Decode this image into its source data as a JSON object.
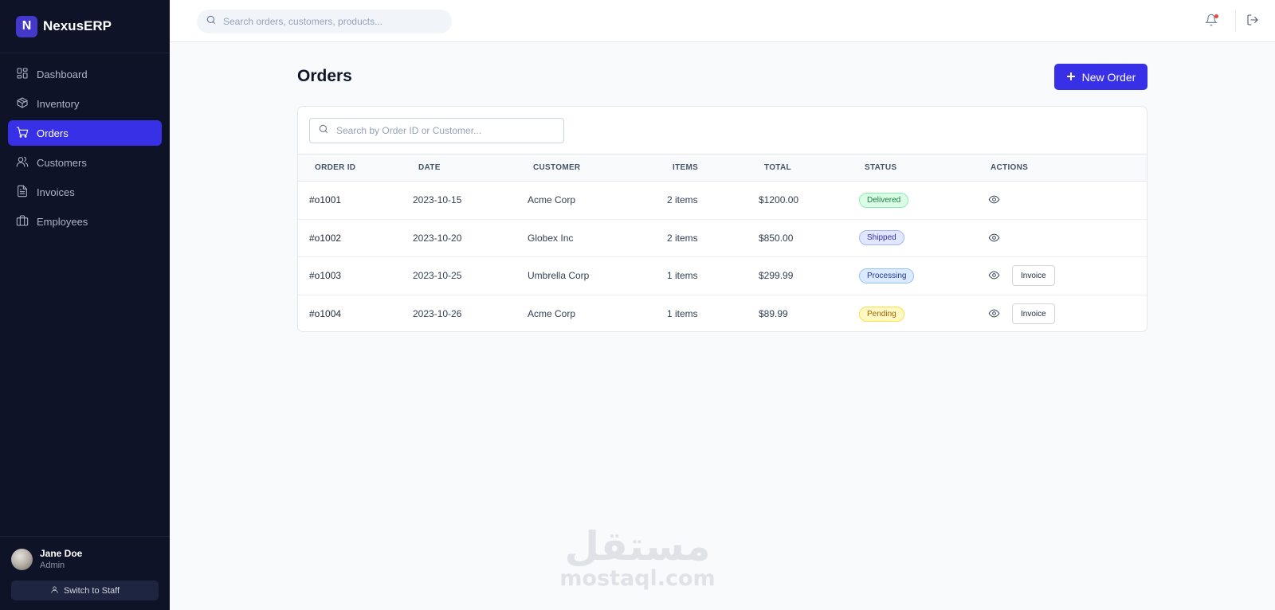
{
  "brand": {
    "logo_letter": "N",
    "name": "NexusERP"
  },
  "sidebar": {
    "items": [
      {
        "label": "Dashboard",
        "icon": "grid-icon",
        "active": false
      },
      {
        "label": "Inventory",
        "icon": "package-icon",
        "active": false
      },
      {
        "label": "Orders",
        "icon": "cart-icon",
        "active": true
      },
      {
        "label": "Customers",
        "icon": "users-icon",
        "active": false
      },
      {
        "label": "Invoices",
        "icon": "file-icon",
        "active": false
      },
      {
        "label": "Employees",
        "icon": "briefcase-icon",
        "active": false
      }
    ],
    "user": {
      "name": "Jane Doe",
      "role": "Admin"
    },
    "switch_label": "Switch to Staff"
  },
  "topbar": {
    "search_placeholder": "Search orders, customers, products...",
    "notification_dot": true
  },
  "page": {
    "title": "Orders",
    "new_order_label": "New Order",
    "table_search_placeholder": "Search by Order ID or Customer..."
  },
  "table": {
    "columns": [
      "ORDER ID",
      "DATE",
      "CUSTOMER",
      "ITEMS",
      "TOTAL",
      "STATUS",
      "ACTIONS"
    ],
    "rows": [
      {
        "id": "#o1001",
        "date": "2023-10-15",
        "customer": "Acme Corp",
        "items": "2 items",
        "total": "$1200.00",
        "status": "Delivered",
        "invoice": ""
      },
      {
        "id": "#o1002",
        "date": "2023-10-20",
        "customer": "Globex Inc",
        "items": "2 items",
        "total": "$850.00",
        "status": "Shipped",
        "invoice": ""
      },
      {
        "id": "#o1003",
        "date": "2023-10-25",
        "customer": "Umbrella Corp",
        "items": "1 items",
        "total": "$299.99",
        "status": "Processing",
        "invoice": "Invoice"
      },
      {
        "id": "#o1004",
        "date": "2023-10-26",
        "customer": "Acme Corp",
        "items": "1 items",
        "total": "$89.99",
        "status": "Pending",
        "invoice": "Invoice"
      }
    ]
  },
  "status_colors": {
    "Delivered": {
      "bg": "#dcfce7",
      "border": "#86efac",
      "text": "#15803d"
    },
    "Shipped": {
      "bg": "#e0e7ff",
      "border": "#a5b4fc",
      "text": "#3730a3"
    },
    "Processing": {
      "bg": "#dbeafe",
      "border": "#93c5fd",
      "text": "#1e3a8a"
    },
    "Pending": {
      "bg": "#fef9c3",
      "border": "#fde047",
      "text": "#a16207"
    }
  },
  "colors": {
    "accent": "#3730e6",
    "sidebar_bg": "#0f1328"
  },
  "watermark": {
    "arabic": "مستقل",
    "latin": "mostaql.com"
  }
}
